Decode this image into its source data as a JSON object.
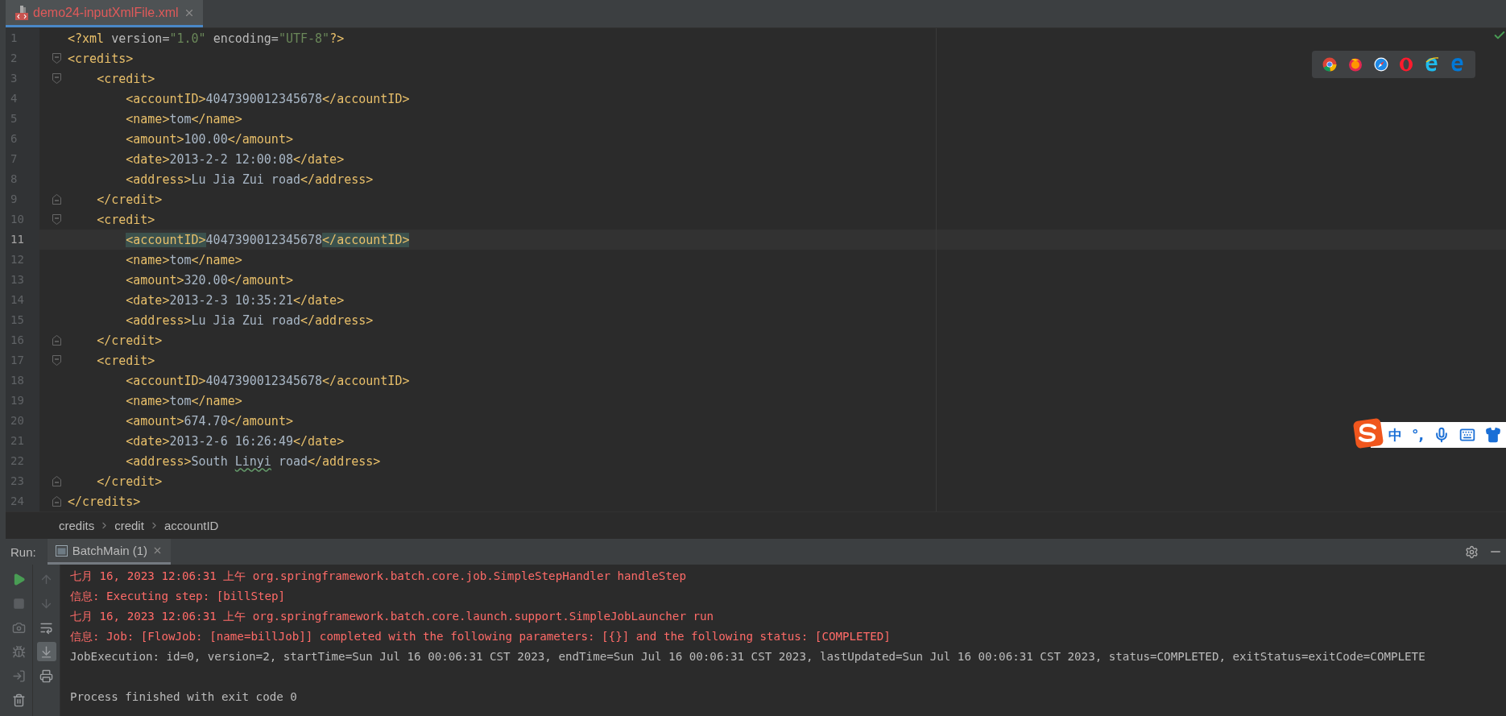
{
  "file_tab": {
    "title": "demo24-inputXmlFile.xml",
    "selected": true,
    "has_errors": true
  },
  "editor": {
    "lines": [
      {
        "number": "1",
        "current": false,
        "fold_open": false,
        "fold_close": false,
        "segments": [
          {
            "kind": "tag",
            "text": "<?xml"
          },
          {
            "kind": "attr",
            "text": " version="
          },
          {
            "kind": "value",
            "text": "\"1.0\""
          },
          {
            "kind": "attr",
            "text": " encoding="
          },
          {
            "kind": "value",
            "text": "\"UTF-8\""
          },
          {
            "kind": "tag",
            "text": "?>"
          }
        ]
      },
      {
        "number": "2",
        "current": false,
        "fold_open": true,
        "fold_close": false,
        "segments": [
          {
            "kind": "tag",
            "text": "<credits>"
          }
        ]
      },
      {
        "number": "3",
        "current": false,
        "fold_open": true,
        "fold_close": false,
        "segments": [
          {
            "kind": "tag",
            "text": "    <credit>"
          }
        ]
      },
      {
        "number": "4",
        "current": false,
        "fold_open": false,
        "fold_close": false,
        "segments": [
          {
            "kind": "tag",
            "text": "        <accountID>"
          },
          {
            "kind": "text",
            "text": "4047390012345678"
          },
          {
            "kind": "tag",
            "text": "</accountID>"
          }
        ]
      },
      {
        "number": "5",
        "current": false,
        "fold_open": false,
        "fold_close": false,
        "segments": [
          {
            "kind": "tag",
            "text": "        <name>"
          },
          {
            "kind": "text",
            "text": "tom"
          },
          {
            "kind": "tag",
            "text": "</name>"
          }
        ]
      },
      {
        "number": "6",
        "current": false,
        "fold_open": false,
        "fold_close": false,
        "segments": [
          {
            "kind": "tag",
            "text": "        <amount>"
          },
          {
            "kind": "text",
            "text": "100.00"
          },
          {
            "kind": "tag",
            "text": "</amount>"
          }
        ]
      },
      {
        "number": "7",
        "current": false,
        "fold_open": false,
        "fold_close": false,
        "segments": [
          {
            "kind": "tag",
            "text": "        <date>"
          },
          {
            "kind": "text",
            "text": "2013-2-2 12:00:08"
          },
          {
            "kind": "tag",
            "text": "</date>"
          }
        ]
      },
      {
        "number": "8",
        "current": false,
        "fold_open": false,
        "fold_close": false,
        "segments": [
          {
            "kind": "tag",
            "text": "        <address>"
          },
          {
            "kind": "text",
            "text": "Lu Jia Zui road"
          },
          {
            "kind": "tag",
            "text": "</address>"
          }
        ]
      },
      {
        "number": "9",
        "current": false,
        "fold_open": false,
        "fold_close": true,
        "segments": [
          {
            "kind": "tag",
            "text": "    </credit>"
          }
        ]
      },
      {
        "number": "10",
        "current": false,
        "fold_open": true,
        "fold_close": false,
        "segments": [
          {
            "kind": "tag",
            "text": "    <credit>"
          }
        ]
      },
      {
        "number": "11",
        "current": true,
        "fold_open": false,
        "fold_close": false,
        "segments": [
          {
            "kind": "match",
            "text": "        <accountID>"
          },
          {
            "kind": "text",
            "text": "4047390012345678"
          },
          {
            "kind": "match",
            "text": "</accountID>"
          }
        ]
      },
      {
        "number": "12",
        "current": false,
        "fold_open": false,
        "fold_close": false,
        "segments": [
          {
            "kind": "tag",
            "text": "        <name>"
          },
          {
            "kind": "text",
            "text": "tom"
          },
          {
            "kind": "tag",
            "text": "</name>"
          }
        ]
      },
      {
        "number": "13",
        "current": false,
        "fold_open": false,
        "fold_close": false,
        "segments": [
          {
            "kind": "tag",
            "text": "        <amount>"
          },
          {
            "kind": "text",
            "text": "320.00"
          },
          {
            "kind": "tag",
            "text": "</amount>"
          }
        ]
      },
      {
        "number": "14",
        "current": false,
        "fold_open": false,
        "fold_close": false,
        "segments": [
          {
            "kind": "tag",
            "text": "        <date>"
          },
          {
            "kind": "text",
            "text": "2013-2-3 10:35:21"
          },
          {
            "kind": "tag",
            "text": "</date>"
          }
        ]
      },
      {
        "number": "15",
        "current": false,
        "fold_open": false,
        "fold_close": false,
        "segments": [
          {
            "kind": "tag",
            "text": "        <address>"
          },
          {
            "kind": "text",
            "text": "Lu Jia Zui road"
          },
          {
            "kind": "tag",
            "text": "</address>"
          }
        ]
      },
      {
        "number": "16",
        "current": false,
        "fold_open": false,
        "fold_close": true,
        "segments": [
          {
            "kind": "tag",
            "text": "    </credit>"
          }
        ]
      },
      {
        "number": "17",
        "current": false,
        "fold_open": true,
        "fold_close": false,
        "segments": [
          {
            "kind": "tag",
            "text": "    <credit>"
          }
        ]
      },
      {
        "number": "18",
        "current": false,
        "fold_open": false,
        "fold_close": false,
        "segments": [
          {
            "kind": "tag",
            "text": "        <accountID>"
          },
          {
            "kind": "text",
            "text": "4047390012345678"
          },
          {
            "kind": "tag",
            "text": "</accountID>"
          }
        ]
      },
      {
        "number": "19",
        "current": false,
        "fold_open": false,
        "fold_close": false,
        "segments": [
          {
            "kind": "tag",
            "text": "        <name>"
          },
          {
            "kind": "text",
            "text": "tom"
          },
          {
            "kind": "tag",
            "text": "</name>"
          }
        ]
      },
      {
        "number": "20",
        "current": false,
        "fold_open": false,
        "fold_close": false,
        "segments": [
          {
            "kind": "tag",
            "text": "        <amount>"
          },
          {
            "kind": "text",
            "text": "674.70"
          },
          {
            "kind": "tag",
            "text": "</amount>"
          }
        ]
      },
      {
        "number": "21",
        "current": false,
        "fold_open": false,
        "fold_close": false,
        "segments": [
          {
            "kind": "tag",
            "text": "        <date>"
          },
          {
            "kind": "text",
            "text": "2013-2-6 16:26:49"
          },
          {
            "kind": "tag",
            "text": "</date>"
          }
        ]
      },
      {
        "number": "22",
        "current": false,
        "fold_open": false,
        "fold_close": false,
        "segments": [
          {
            "kind": "tag",
            "text": "        <address>"
          },
          {
            "kind": "text",
            "text": "South "
          },
          {
            "kind": "typo",
            "text": "Linyi"
          },
          {
            "kind": "text",
            "text": " road"
          },
          {
            "kind": "tag",
            "text": "</address>"
          }
        ]
      },
      {
        "number": "23",
        "current": false,
        "fold_open": false,
        "fold_close": true,
        "segments": [
          {
            "kind": "tag",
            "text": "    </credit>"
          }
        ]
      },
      {
        "number": "24",
        "current": false,
        "fold_open": false,
        "fold_close": true,
        "segments": [
          {
            "kind": "tag",
            "text": "</credits>"
          }
        ]
      }
    ]
  },
  "breadcrumbs": [
    "credits",
    "credit",
    "accountID"
  ],
  "run_panel": {
    "label": "Run:",
    "tabs": [
      {
        "title": "BatchMain (1)",
        "selected": true
      }
    ],
    "console": [
      {
        "kind": "error",
        "text": "七月 16, 2023 12:06:31 上午 org.springframework.batch.core.job.SimpleStepHandler handleStep"
      },
      {
        "kind": "error",
        "text": "信息: Executing step: [billStep]"
      },
      {
        "kind": "error",
        "text": "七月 16, 2023 12:06:31 上午 org.springframework.batch.core.launch.support.SimpleJobLauncher run"
      },
      {
        "kind": "error",
        "text": "信息: Job: [FlowJob: [name=billJob]] completed with the following parameters: [{}] and the following status: [COMPLETED]"
      },
      {
        "kind": "output",
        "text": "JobExecution: id=0, version=2, startTime=Sun Jul 16 00:06:31 CST 2023, endTime=Sun Jul 16 00:06:31 CST 2023, lastUpdated=Sun Jul 16 00:06:31 CST 2023, status=COMPLETED, exitStatus=exitCode=COMPLETE"
      },
      {
        "kind": "blank"
      },
      {
        "kind": "output",
        "text": "Process finished with exit code 0"
      }
    ]
  },
  "ime_bar": {
    "items": [
      {
        "kind": "text",
        "text": "中"
      },
      {
        "kind": "text",
        "text": "°,"
      },
      {
        "kind": "mic"
      },
      {
        "kind": "keyboard"
      },
      {
        "kind": "skin"
      }
    ]
  }
}
